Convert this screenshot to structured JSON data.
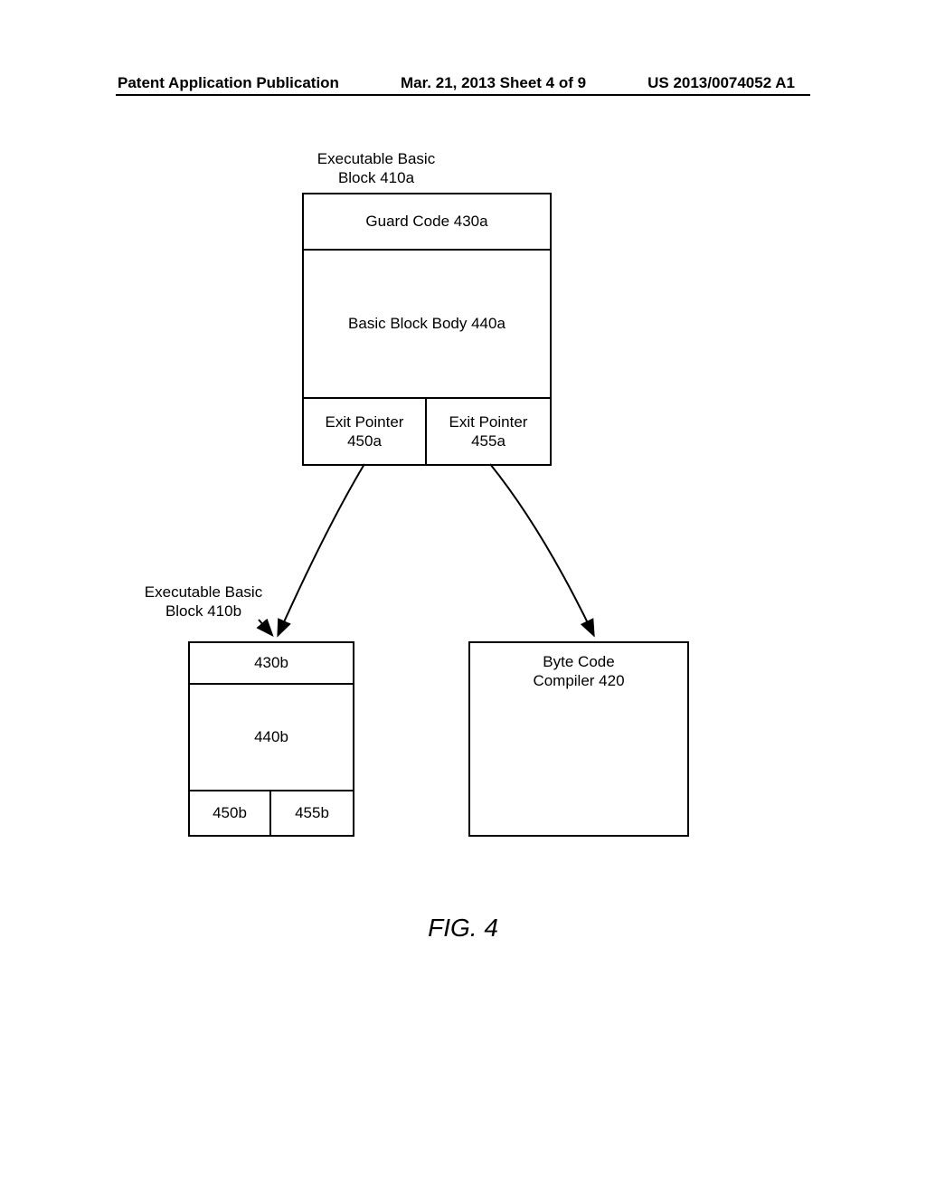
{
  "header": {
    "left": "Patent Application Publication",
    "center": "Mar. 21, 2013  Sheet 4 of 9",
    "right": "US 2013/0074052 A1"
  },
  "diagram": {
    "block_410a_label": "Executable Basic\nBlock 410a",
    "guard_code_a": "Guard Code 430a",
    "body_a": "Basic Block Body 440a",
    "exit_pointer_left_a": "Exit Pointer\n450a",
    "exit_pointer_right_a": "Exit Pointer\n455a",
    "block_410b_label": "Executable Basic\nBlock 410b",
    "guard_code_b": "430b",
    "body_b": "440b",
    "exit_pointer_left_b": "450b",
    "exit_pointer_right_b": "455b",
    "compiler": "Byte Code\nCompiler 420",
    "figure_caption": "FIG. 4"
  }
}
